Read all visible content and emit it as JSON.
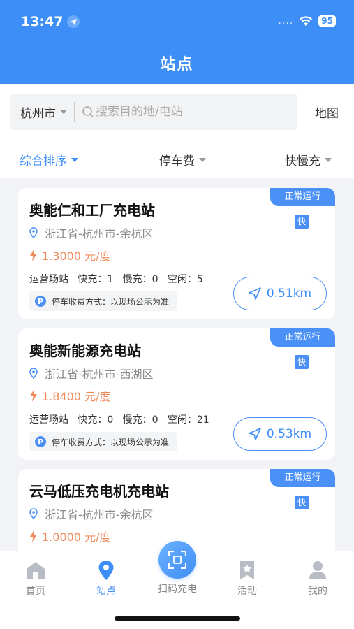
{
  "status_bar": {
    "time": "13:47",
    "signal_dots": "....",
    "battery": "95"
  },
  "header": {
    "title": "站点"
  },
  "search": {
    "city": "杭州市",
    "placeholder": "搜索目的地/电站",
    "map_label": "地图"
  },
  "filters": [
    {
      "label": "综合排序",
      "active": true
    },
    {
      "label": "停车费",
      "active": false
    },
    {
      "label": "快慢充",
      "active": false
    }
  ],
  "stations": [
    {
      "name": "奥能仁和工厂充电站",
      "status": "正常运行",
      "charge_type": "快",
      "address": "浙江省-杭州市-余杭区",
      "price": "1.3000 元/度",
      "stats": "运营场站   快充：1   慢充：0   空闲：5",
      "parking": "停车收费方式：以现场公示为准",
      "distance": "0.51km"
    },
    {
      "name": "奥能新能源充电站",
      "status": "正常运行",
      "charge_type": "快",
      "address": "浙江省-杭州市-西湖区",
      "price": "1.8400 元/度",
      "stats": "运营场站   快充：0   慢充：0   空闲：21",
      "parking": "停车收费方式：以现场公示为准",
      "distance": "0.53km"
    },
    {
      "name": "云马低压充电机充电站",
      "status": "正常运行",
      "charge_type": "快",
      "address": "浙江省-杭州市-余杭区",
      "price": "1.0000 元/度"
    }
  ],
  "tabbar": {
    "home": "首页",
    "stations": "站点",
    "scan": "扫码充电",
    "activity": "活动",
    "mine": "我的"
  },
  "colors": {
    "primary": "#3d8ef7",
    "price": "#ef8b5b"
  }
}
